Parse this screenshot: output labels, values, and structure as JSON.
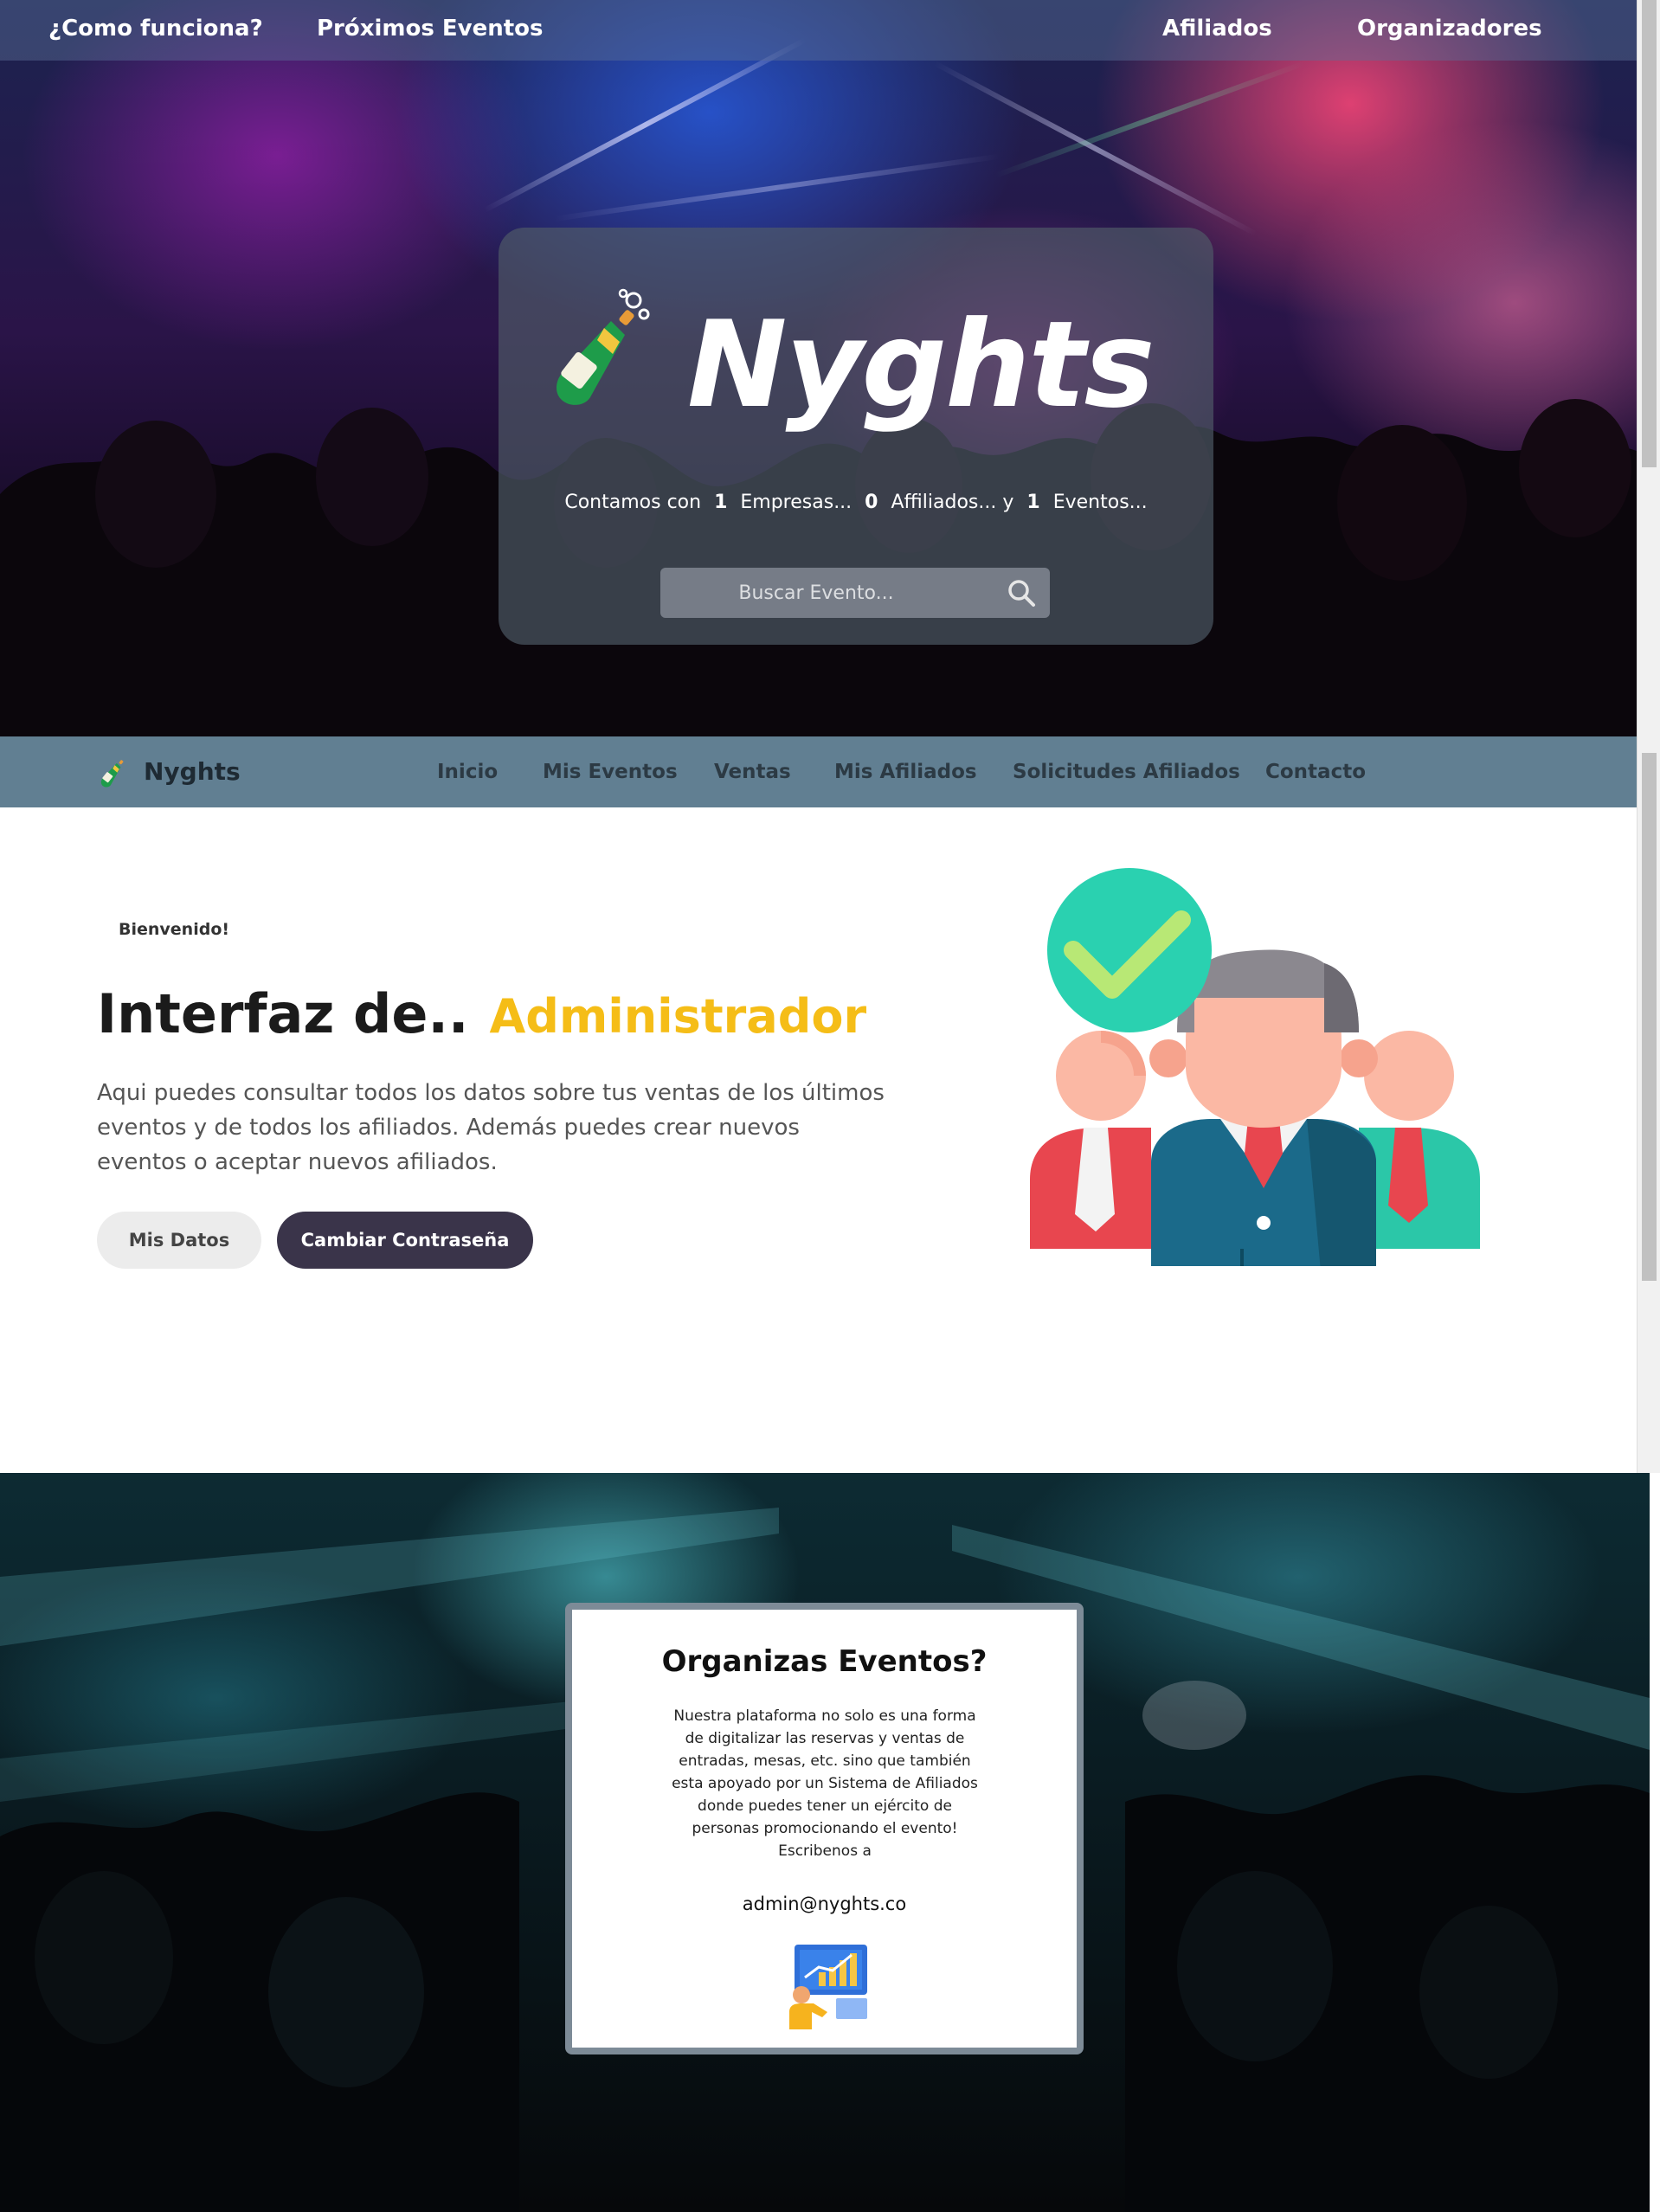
{
  "topnav": {
    "items": [
      "¿Como funciona?",
      "Próximos Eventos",
      "Afiliados",
      "Organizadores"
    ]
  },
  "hero": {
    "brand": "Nyghts",
    "stats": {
      "prefix": "Contamos con",
      "empresas_count": "1",
      "empresas_label": "Empresas...",
      "afiliados_count": "0",
      "afiliados_label": "Affiliados... y",
      "eventos_count": "1",
      "eventos_label": "Eventos..."
    },
    "search_placeholder": "Buscar Evento..."
  },
  "mainnav": {
    "brand": "Nyghts",
    "items": [
      "Inicio",
      "Mis Eventos",
      "Ventas",
      "Mis Afiliados",
      "Solicitudes Afiliados",
      "Contacto"
    ]
  },
  "welcome": {
    "tag": "Bienvenido!",
    "title": "Interfaz de..",
    "highlight": "Administrador",
    "description": "Aqui puedes consultar todos los datos sobre tus ventas de los últimos eventos y de todos los afiliados. Además puedes crear nuevos eventos o aceptar nuevos afiliados.",
    "btn_datos": "Mis Datos",
    "btn_password": "Cambiar Contraseña"
  },
  "organizer": {
    "title": "Organizas Eventos?",
    "text": "Nuestra plataforma no solo es una forma de digitalizar las reservas y ventas de entradas, mesas, etc. sino que también esta apoyado por un Sistema de Afiliados donde puedes tener un ejército de personas promocionando el evento! Escribenos a",
    "email": "admin@nyghts.co"
  },
  "icons": {
    "logo": "champagne-bottle-icon",
    "search": "magnifier-icon",
    "illustration": "team-approved-icon",
    "card_art": "analytics-presenter-icon"
  },
  "colors": {
    "accent": "#f5bd17",
    "nav_bg": "#617f92",
    "dark_button": "#3a344a"
  }
}
